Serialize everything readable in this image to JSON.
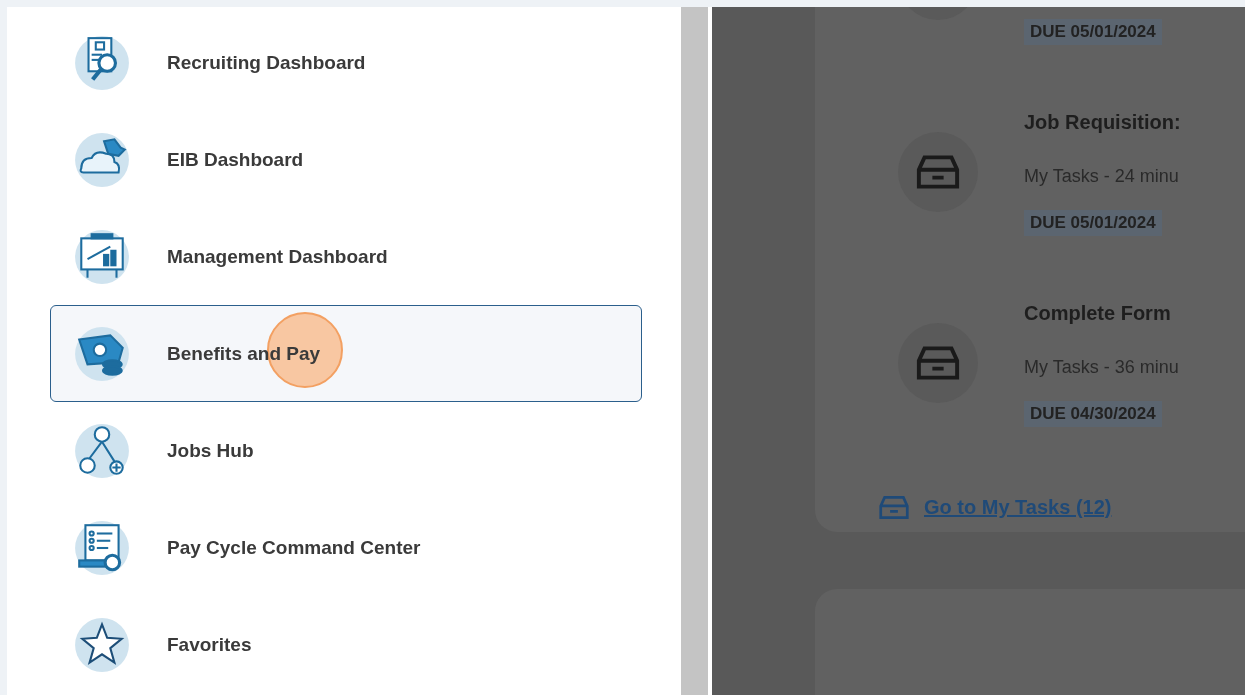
{
  "menu": {
    "items": [
      {
        "label": "Recruiting Dashboard",
        "kind": "recruiting",
        "selected": false
      },
      {
        "label": "EIB Dashboard",
        "kind": "puzzle",
        "selected": false
      },
      {
        "label": "Management Dashboard",
        "kind": "chart",
        "selected": false
      },
      {
        "label": "Benefits and Pay",
        "kind": "money",
        "selected": true
      },
      {
        "label": "Jobs Hub",
        "kind": "org",
        "selected": false
      },
      {
        "label": "Pay Cycle Command Center",
        "kind": "list",
        "selected": false
      },
      {
        "label": "Favorites",
        "kind": "star",
        "selected": false
      }
    ]
  },
  "tasks": {
    "items": [
      {
        "due": "DUE 05/01/2024"
      },
      {
        "title": "Job Requisition:",
        "subtitle": "My Tasks - 24 minu",
        "due": "DUE 05/01/2024"
      },
      {
        "title": "Complete Form",
        "subtitle": "My Tasks - 36 minu",
        "due": "DUE 04/30/2024"
      }
    ],
    "link": "Go to My Tasks (12)"
  }
}
